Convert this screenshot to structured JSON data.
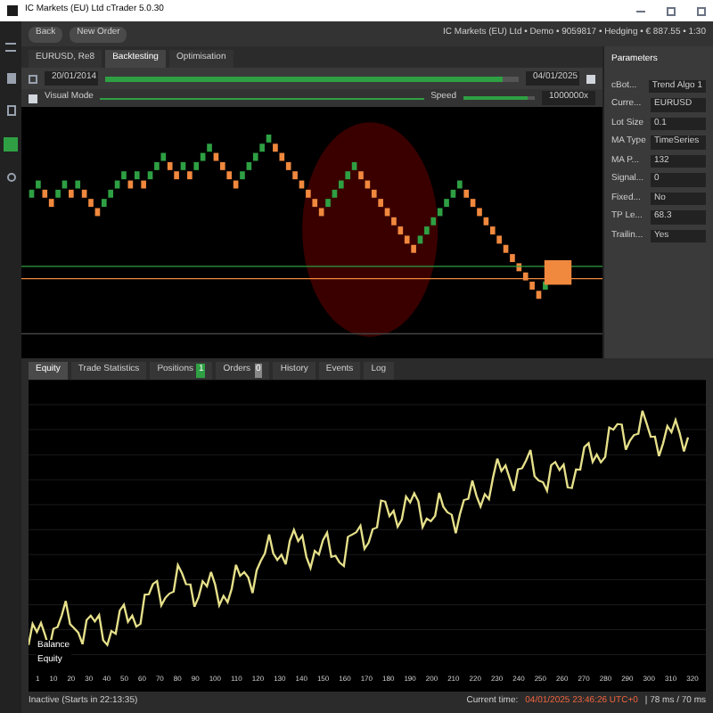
{
  "window": {
    "title": "IC Markets (EU) Ltd cTrader 5.0.30"
  },
  "toolbar": {
    "buttons": [
      "Back",
      "New Order"
    ],
    "account": "IC Markets (EU) Ltd • Demo • 9059817 • Hedging • € 887.55 • 1:30"
  },
  "tabs": [
    {
      "label": "EURUSD, Re8",
      "selected": false
    },
    {
      "label": "Backtesting",
      "selected": true
    },
    {
      "label": "Optimisation",
      "selected": false
    }
  ],
  "range": {
    "start": "20/01/2014",
    "end": "04/01/2025",
    "level": 0.96
  },
  "visual_mode": {
    "label": "Visual Mode",
    "checked": true,
    "speed_label": "Speed",
    "speed": "1000000x",
    "level": 0.9
  },
  "parameters": {
    "title": "Parameters",
    "rows": [
      {
        "name": "cBot...",
        "value": "Trend Algo 1"
      },
      {
        "name": "Curre...",
        "value": "EURUSD"
      },
      {
        "name": "Lot Size",
        "value": "0.1"
      },
      {
        "name": "MA Type",
        "value": "TimeSeries"
      },
      {
        "name": "MA P...",
        "value": "132"
      },
      {
        "name": "Signal...",
        "value": "0"
      },
      {
        "name": "Fixed...",
        "value": "No"
      },
      {
        "name": "TP Le...",
        "value": "68.3"
      },
      {
        "name": "Trailin...",
        "value": "Yes"
      }
    ]
  },
  "bottom_tabs": [
    {
      "label": "Equity",
      "selected": true
    },
    {
      "label": "Trade Statistics",
      "selected": false
    },
    {
      "label": "Positions",
      "count": "1",
      "selected": false
    },
    {
      "label": "Orders",
      "count": "0",
      "selected": false
    },
    {
      "label": "History",
      "selected": false
    },
    {
      "label": "Events",
      "selected": false
    },
    {
      "label": "Log",
      "selected": false
    }
  ],
  "equity_chart": {
    "legend": [
      "Balance",
      "Equity"
    ],
    "x_ticks": [
      "1",
      "10",
      "20",
      "30",
      "40",
      "50",
      "60",
      "70",
      "80",
      "90",
      "100",
      "110",
      "120",
      "130",
      "140",
      "150",
      "160",
      "170",
      "180",
      "190",
      "200",
      "210",
      "220",
      "230",
      "240",
      "250",
      "260",
      "270",
      "280",
      "290",
      "300",
      "310",
      "320"
    ]
  },
  "status_bar": {
    "state": "Inactive (Starts in 22:13:35)",
    "time_label": "Current time:",
    "time": "04/01/2025 23:46:26 UTC+0",
    "latency": "| 78 ms / 70 ms"
  }
}
